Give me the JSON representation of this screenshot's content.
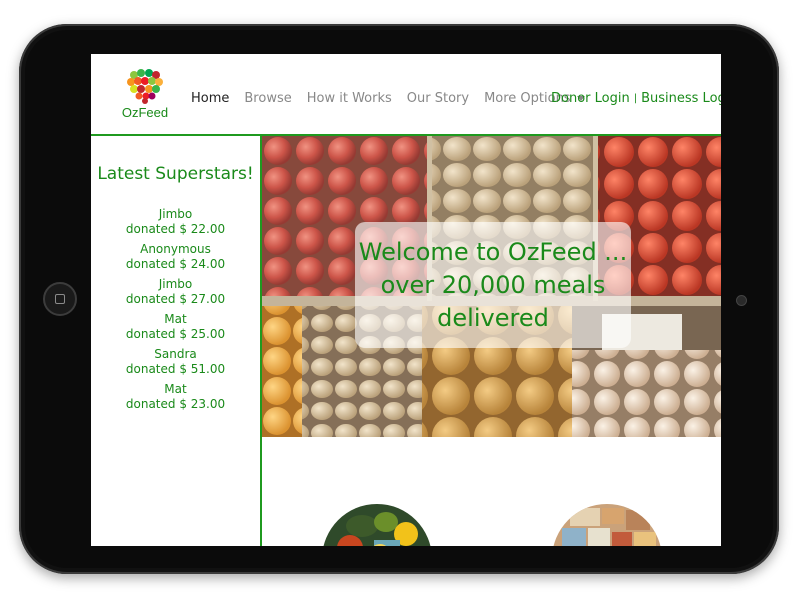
{
  "brand": {
    "name": "OzFeed"
  },
  "nav": {
    "items": [
      {
        "label": "Home",
        "active": true
      },
      {
        "label": "Browse",
        "active": false
      },
      {
        "label": "How it Works",
        "active": false
      },
      {
        "label": "Our Story",
        "active": false
      },
      {
        "label": "More Options",
        "active": false,
        "dropdown": true
      }
    ],
    "donor_login": "Donor Login",
    "separator": "|",
    "business_login": "Business Login"
  },
  "sidebar": {
    "title": "Latest Superstars!",
    "donations": [
      {
        "name": "Jimbo",
        "amount": "donated $ 22.00"
      },
      {
        "name": "Anonymous",
        "amount": "donated $ 24.00"
      },
      {
        "name": "Jimbo",
        "amount": "donated $ 27.00"
      },
      {
        "name": "Mat",
        "amount": "donated $ 25.00"
      },
      {
        "name": "Sandra",
        "amount": "donated $ 51.00"
      },
      {
        "name": "Mat",
        "amount": "donated $ 23.00"
      }
    ]
  },
  "hero": {
    "line1": "Welcome to OzFeed ...",
    "line2": "over 20,000 meals",
    "line3": "delivered"
  },
  "colors": {
    "brand_green": "#1a8a1a",
    "border_green": "#1f9a1f",
    "nav_inactive": "#888888",
    "nav_active": "#222222"
  }
}
